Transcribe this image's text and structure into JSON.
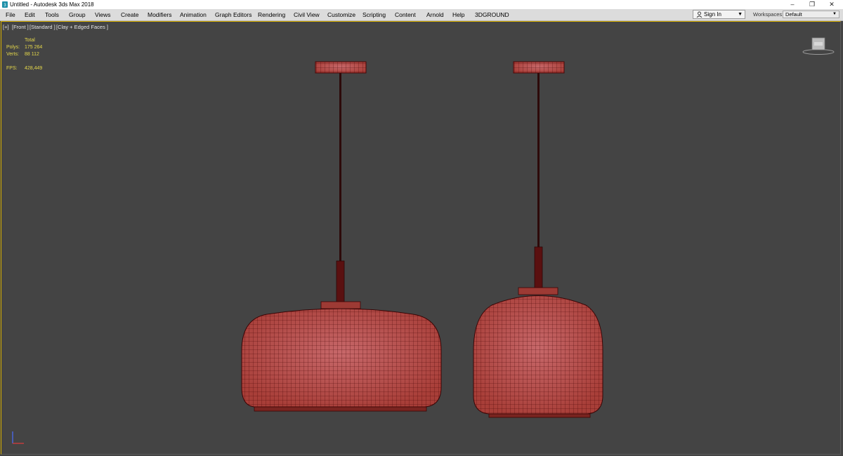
{
  "window": {
    "title": "Untitled - Autodesk 3ds Max 2018",
    "controls": {
      "minimize": "–",
      "restore": "❐",
      "close": "✕"
    }
  },
  "menu": {
    "items": [
      "File",
      "Edit",
      "Tools",
      "Group",
      "Views",
      "Create",
      "Modifiers",
      "Animation",
      "Graph Editors",
      "Rendering",
      "Civil View",
      "Customize",
      "Scripting",
      "Content",
      "Arnold",
      "Help",
      "3DGROUND"
    ]
  },
  "account": {
    "sign_in": "Sign In",
    "caret": "▼"
  },
  "workspaces": {
    "label": "Workspaces:",
    "value": "Default",
    "caret": "▼"
  },
  "viewport": {
    "labels": [
      "[+]",
      "[Front ]",
      "[Standard ]",
      "[Clay + Edged Faces ]"
    ],
    "stats": {
      "header": "Total",
      "polys_label": "Polys:",
      "polys_value": "175 264",
      "verts_label": "Verts:",
      "verts_value": "88 112",
      "fps_label": "FPS:",
      "fps_value": "428,449"
    }
  },
  "colors": {
    "viewport_bg": "#444444",
    "mesh_fill": "#b8524b",
    "mesh_wire": "#4a0606",
    "stats_text": "#e6d84a",
    "active_border": "#d8b000"
  },
  "icons": {
    "app": "3dsmax-app-icon",
    "user": "user-icon",
    "viewcube": "viewcube-icon",
    "axis": "axis-tripod-icon"
  }
}
